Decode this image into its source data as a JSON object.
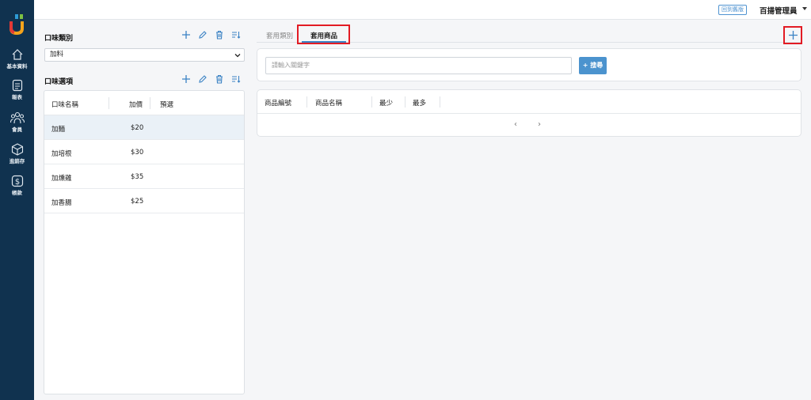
{
  "nav": [
    {
      "label": "基本資料",
      "icon": "home-icon"
    },
    {
      "label": "報表",
      "icon": "report-icon"
    },
    {
      "label": "會員",
      "icon": "members-icon"
    },
    {
      "label": "進銷存",
      "icon": "inventory-icon"
    },
    {
      "label": "帳款",
      "icon": "payment-icon"
    }
  ],
  "topbar": {
    "back_label": "回到舊版",
    "user_name": "百揚管理員"
  },
  "category": {
    "title": "口味類別",
    "selected": "加料"
  },
  "options": {
    "title": "口味選項",
    "columns": [
      "口味名稱",
      "加價",
      "預選"
    ],
    "rows": [
      {
        "name": "加麵",
        "price": "$20"
      },
      {
        "name": "加培根",
        "price": "$30"
      },
      {
        "name": "加燻雞",
        "price": "$35"
      },
      {
        "name": "加香腸",
        "price": "$25"
      }
    ]
  },
  "tabs": [
    "套用類別",
    "套用商品"
  ],
  "search": {
    "placeholder": "請輸入關鍵字",
    "button": "+ 搜尋"
  },
  "products": {
    "columns": [
      "商品編號",
      "商品名稱",
      "最少",
      "最多"
    ],
    "prev": "‹",
    "next": "›"
  },
  "colors": {
    "sidebar": "#10324f",
    "accent": "#4b93ce",
    "highlight": "#e21b24"
  }
}
